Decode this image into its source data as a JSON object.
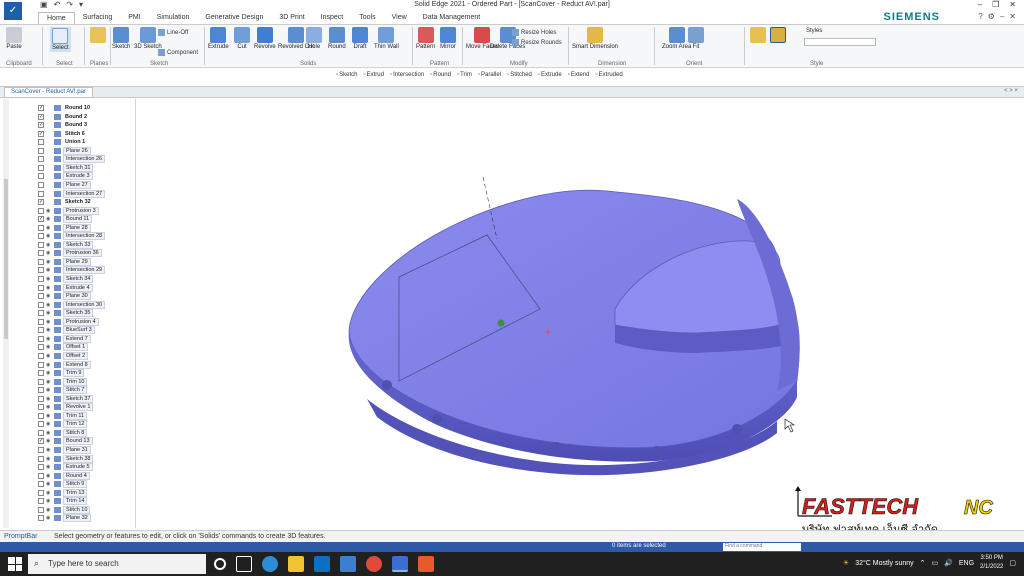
{
  "window": {
    "title": "Solid Edge 2021 - Ordered Part - [ScanCover - Reduct AV!.par]",
    "brand": "SIEMENS"
  },
  "tabs": [
    "Home",
    "Surfacing",
    "PMI",
    "Simulation",
    "Generative Design",
    "3D Print",
    "Inspect",
    "Tools",
    "View",
    "Data Management"
  ],
  "active_tab": "Home",
  "ribbon": {
    "groups": [
      "Clipboard",
      "Select",
      "Planes",
      "Sketch",
      "Solids",
      "Pattern",
      "Modify",
      "Dimension",
      "Orient",
      "Style"
    ],
    "paste": "Paste",
    "select": "Select",
    "sketch": "Sketch",
    "sketch_3d": "3D Sketch",
    "line_off": "Line-Off",
    "component": "Component",
    "extrude": "Extrude",
    "cut": "Cut",
    "revolve": "Revolve",
    "revolved_cut": "Revolved Cut",
    "hole": "Hole",
    "round": "Round",
    "draft": "Draft",
    "thin_wall": "Thin Wall",
    "pattern": "Pattern",
    "mirror": "Mirror",
    "move_faces": "Move Faces",
    "delete_faces": "Delete Faces",
    "resize_holes": "Resize Holes",
    "resize_rounds": "Resize Rounds",
    "smart_dimension": "Smart Dimension",
    "zoom_area": "Zoom Area",
    "fit": "Fit",
    "styles": "Styles"
  },
  "command_bar": [
    "Sketch",
    "Extrud",
    "Intersection",
    "Round",
    "Trim",
    "Parallel",
    "Stitched",
    "Extrude",
    "Extend",
    "Extruded"
  ],
  "doc_tab": "ScanCover - Reduct AV!.par",
  "doc_tab_right": "< > ×",
  "tree": [
    {
      "label": "Round 10",
      "checked": true,
      "bold": true,
      "eye": false,
      "indent": 0
    },
    {
      "label": "Bound 2",
      "checked": true,
      "bold": true,
      "eye": false,
      "indent": 0
    },
    {
      "label": "Bound 3",
      "checked": true,
      "bold": true,
      "eye": false,
      "indent": 0
    },
    {
      "label": "Stitch 6",
      "checked": true,
      "bold": true,
      "eye": false,
      "indent": 0
    },
    {
      "label": "Union 1",
      "checked": false,
      "bold": true,
      "eye": false,
      "indent": 1
    },
    {
      "label": "Plane 26",
      "checked": false,
      "bold": false,
      "eye": false,
      "indent": 0
    },
    {
      "label": "Intersection 26",
      "checked": false,
      "bold": false,
      "eye": false,
      "indent": 0
    },
    {
      "label": "Sketch 31",
      "checked": false,
      "bold": false,
      "eye": false,
      "indent": 0
    },
    {
      "label": "Extrude 3",
      "checked": false,
      "bold": false,
      "eye": false,
      "indent": 0
    },
    {
      "label": "Plane 27",
      "checked": false,
      "bold": false,
      "eye": false,
      "indent": 0
    },
    {
      "label": "Intersection 27",
      "checked": false,
      "bold": false,
      "eye": false,
      "indent": 0
    },
    {
      "label": "Sketch 32",
      "checked": true,
      "bold": true,
      "eye": false,
      "indent": 0
    },
    {
      "label": "Protrusion 3",
      "checked": false,
      "bold": false,
      "eye": true,
      "indent": 1
    },
    {
      "label": "Bound 11",
      "checked": true,
      "bold": false,
      "eye": true,
      "indent": 1
    },
    {
      "label": "Plane 28",
      "checked": false,
      "bold": false,
      "eye": true,
      "indent": 1
    },
    {
      "label": "Intersection 28",
      "checked": false,
      "bold": false,
      "eye": true,
      "indent": 1
    },
    {
      "label": "Sketch 33",
      "checked": false,
      "bold": false,
      "eye": true,
      "indent": 1
    },
    {
      "label": "Protrusion 36",
      "checked": false,
      "bold": false,
      "eye": true,
      "indent": 1
    },
    {
      "label": "Plane 29",
      "checked": false,
      "bold": false,
      "eye": true,
      "indent": 1
    },
    {
      "label": "Intersection 29",
      "checked": false,
      "bold": false,
      "eye": true,
      "indent": 1
    },
    {
      "label": "Sketch 34",
      "checked": false,
      "bold": false,
      "eye": true,
      "indent": 1
    },
    {
      "label": "Extrude 4",
      "checked": false,
      "bold": false,
      "eye": true,
      "indent": 1
    },
    {
      "label": "Plane 30",
      "checked": false,
      "bold": false,
      "eye": true,
      "indent": 1
    },
    {
      "label": "Intersection 30",
      "checked": false,
      "bold": false,
      "eye": true,
      "indent": 1
    },
    {
      "label": "Sketch 35",
      "checked": false,
      "bold": false,
      "eye": true,
      "indent": 1
    },
    {
      "label": "Protrusion 4",
      "checked": false,
      "bold": false,
      "eye": true,
      "indent": 1
    },
    {
      "label": "BlueSurf 3",
      "checked": false,
      "bold": false,
      "eye": true,
      "indent": 1
    },
    {
      "label": "Extend 7",
      "checked": false,
      "bold": false,
      "eye": true,
      "indent": 1
    },
    {
      "label": "Offset 1",
      "checked": false,
      "bold": false,
      "eye": true,
      "indent": 1
    },
    {
      "label": "Offset 2",
      "checked": false,
      "bold": false,
      "eye": true,
      "indent": 1
    },
    {
      "label": "Extend 8",
      "checked": false,
      "bold": false,
      "eye": true,
      "indent": 1
    },
    {
      "label": "Trim 9",
      "checked": false,
      "bold": false,
      "eye": true,
      "indent": 1
    },
    {
      "label": "Trim 10",
      "checked": false,
      "bold": false,
      "eye": true,
      "indent": 1
    },
    {
      "label": "Stitch 7",
      "checked": false,
      "bold": false,
      "eye": true,
      "indent": 1
    },
    {
      "label": "Sketch 37",
      "checked": false,
      "bold": false,
      "eye": true,
      "indent": 1
    },
    {
      "label": "Revolve 1",
      "checked": false,
      "bold": false,
      "eye": true,
      "indent": 1
    },
    {
      "label": "Trim 11",
      "checked": false,
      "bold": false,
      "eye": true,
      "indent": 1
    },
    {
      "label": "Trim 12",
      "checked": false,
      "bold": false,
      "eye": true,
      "indent": 1
    },
    {
      "label": "Stitch 8",
      "checked": false,
      "bold": false,
      "eye": true,
      "indent": 1
    },
    {
      "label": "Bound 13",
      "checked": true,
      "bold": false,
      "eye": true,
      "indent": 1
    },
    {
      "label": "Plane 31",
      "checked": false,
      "bold": false,
      "eye": true,
      "indent": 1
    },
    {
      "label": "Sketch 38",
      "checked": false,
      "bold": false,
      "eye": true,
      "indent": 1
    },
    {
      "label": "Extrude 5",
      "checked": false,
      "bold": false,
      "eye": true,
      "indent": 1
    },
    {
      "label": "Round 4",
      "checked": false,
      "bold": false,
      "eye": true,
      "indent": 1
    },
    {
      "label": "Stitch 9",
      "checked": false,
      "bold": false,
      "eye": true,
      "indent": 1
    },
    {
      "label": "Trim 13",
      "checked": false,
      "bold": false,
      "eye": true,
      "indent": 1
    },
    {
      "label": "Trim 14",
      "checked": false,
      "bold": false,
      "eye": true,
      "indent": 1
    },
    {
      "label": "Stitch 10",
      "checked": false,
      "bold": false,
      "eye": true,
      "indent": 1
    },
    {
      "label": "Plane 32",
      "checked": false,
      "bold": false,
      "eye": true,
      "indent": 1
    }
  ],
  "prompt": {
    "label": "PromptBar",
    "text": "Select geometry or features to edit, or click on 'Solids' commands to create 3D features."
  },
  "status": {
    "selection": "0 items are selected",
    "find_placeholder": "Find a command"
  },
  "taskbar": {
    "search_placeholder": "Type here to search",
    "weather": "32°C  Mostly sunny",
    "lang": "ENG",
    "time": "3:50 PM",
    "date": "2/1/2022"
  },
  "logo": {
    "text": "FASTTECH NC",
    "thai": "บริษัท ฟาสท์เทค เอ็นซี จำกัด"
  },
  "colors": {
    "part": "#7f7fe6",
    "part_dark": "#5c5cc6",
    "accent_blue": "#2e5aa6",
    "brand": "#0e7c86"
  }
}
